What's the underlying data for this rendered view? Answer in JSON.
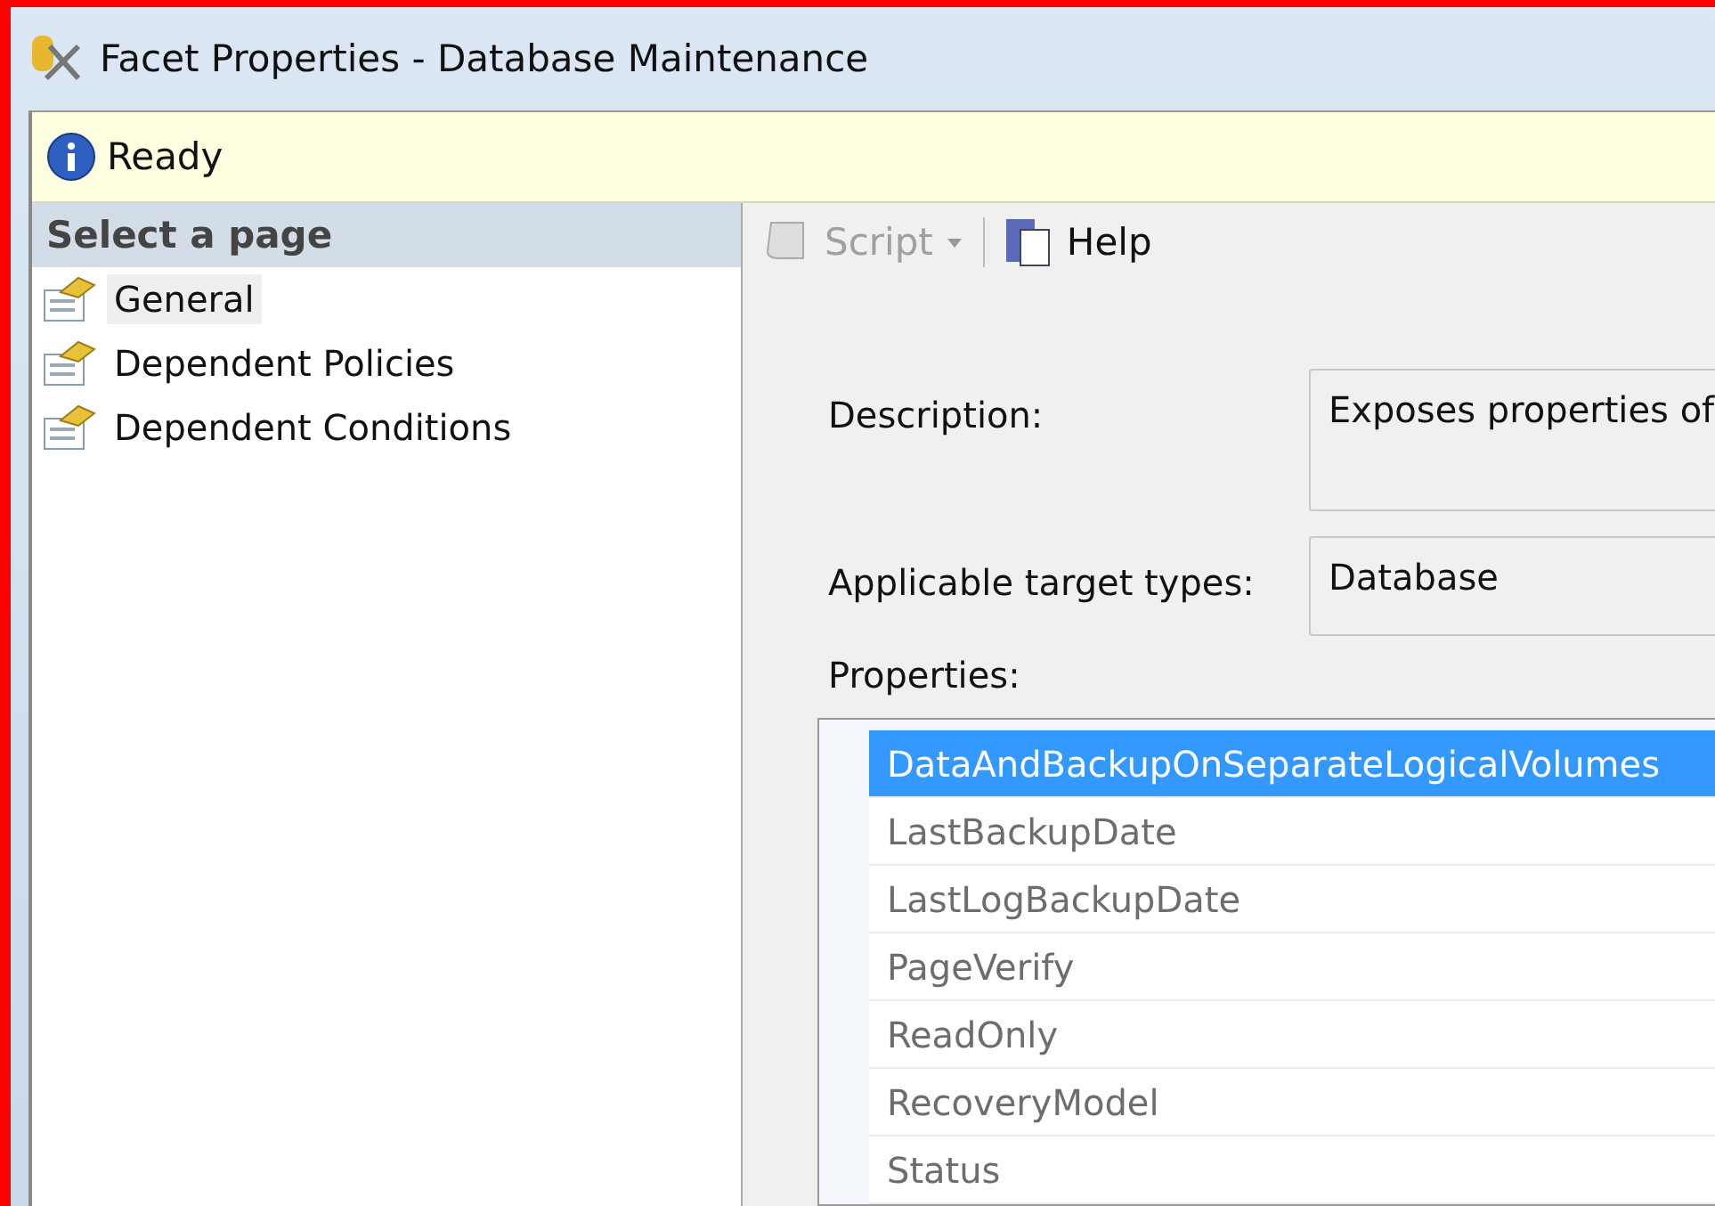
{
  "window": {
    "title": "Facet Properties - Database Maintenance"
  },
  "status": {
    "text": "Ready"
  },
  "sidebar": {
    "header": "Select a page",
    "items": [
      {
        "label": "General",
        "selected": true
      },
      {
        "label": "Dependent Policies",
        "selected": false
      },
      {
        "label": "Dependent Conditions",
        "selected": false
      }
    ]
  },
  "toolbar": {
    "buttons": [
      {
        "label": "Script",
        "kind": "dropdown",
        "disabled": true
      },
      {
        "label": "Help",
        "kind": "plain",
        "disabled": false
      }
    ]
  },
  "form": {
    "fields": [
      {
        "label": "Description:",
        "value": "Exposes properties of",
        "kind": "tall"
      },
      {
        "label": "Applicable target types:",
        "value": "Database",
        "kind": "short"
      }
    ],
    "properties_label": "Properties:"
  },
  "properties": [
    {
      "name": "DataAndBackupOnSeparateLogicalVolumes",
      "selected": true
    },
    {
      "name": "LastBackupDate",
      "selected": false
    },
    {
      "name": "LastLogBackupDate",
      "selected": false
    },
    {
      "name": "PageVerify",
      "selected": false
    },
    {
      "name": "ReadOnly",
      "selected": false
    },
    {
      "name": "RecoveryModel",
      "selected": false
    },
    {
      "name": "Status",
      "selected": false
    }
  ]
}
